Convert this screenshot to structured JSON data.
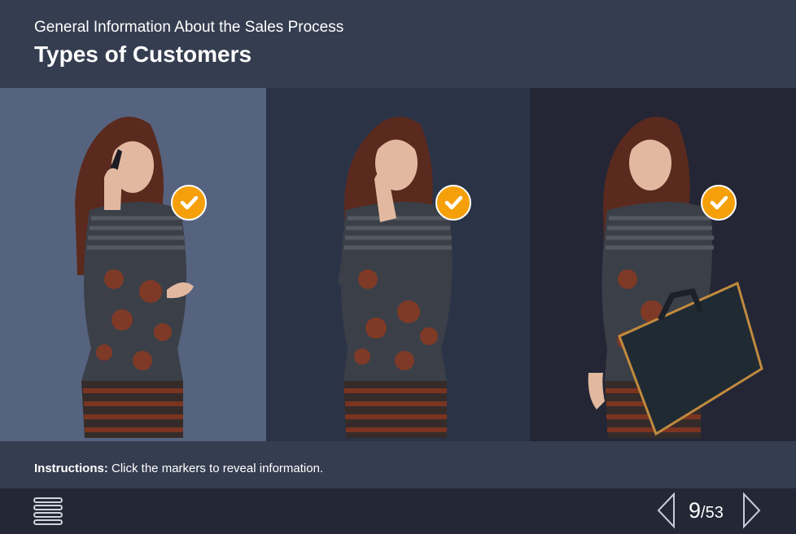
{
  "header": {
    "subtitle": "General Information About the Sales Process",
    "title": "Types of Customers"
  },
  "panels": [
    {
      "name": "customer-on-phone",
      "background": "#56637f",
      "marker_icon": "checkmark-icon",
      "marker_state": "visited"
    },
    {
      "name": "customer-thinking",
      "background": "#2b3347",
      "marker_icon": "checkmark-icon",
      "marker_state": "visited"
    },
    {
      "name": "customer-with-bag",
      "background": "#242635",
      "marker_icon": "checkmark-icon",
      "marker_state": "visited"
    }
  ],
  "instructions": {
    "label": "Instructions:",
    "text": " Click the markers to reveal information."
  },
  "footer": {
    "menu_icon": "hamburger-menu-icon",
    "prev_icon": "chevron-left-icon",
    "next_icon": "chevron-right-icon",
    "page_current": "9",
    "page_total": "/53"
  },
  "colors": {
    "header_bg": "#353d50",
    "footer_bg": "#232736",
    "accent": "#f5a00a"
  }
}
